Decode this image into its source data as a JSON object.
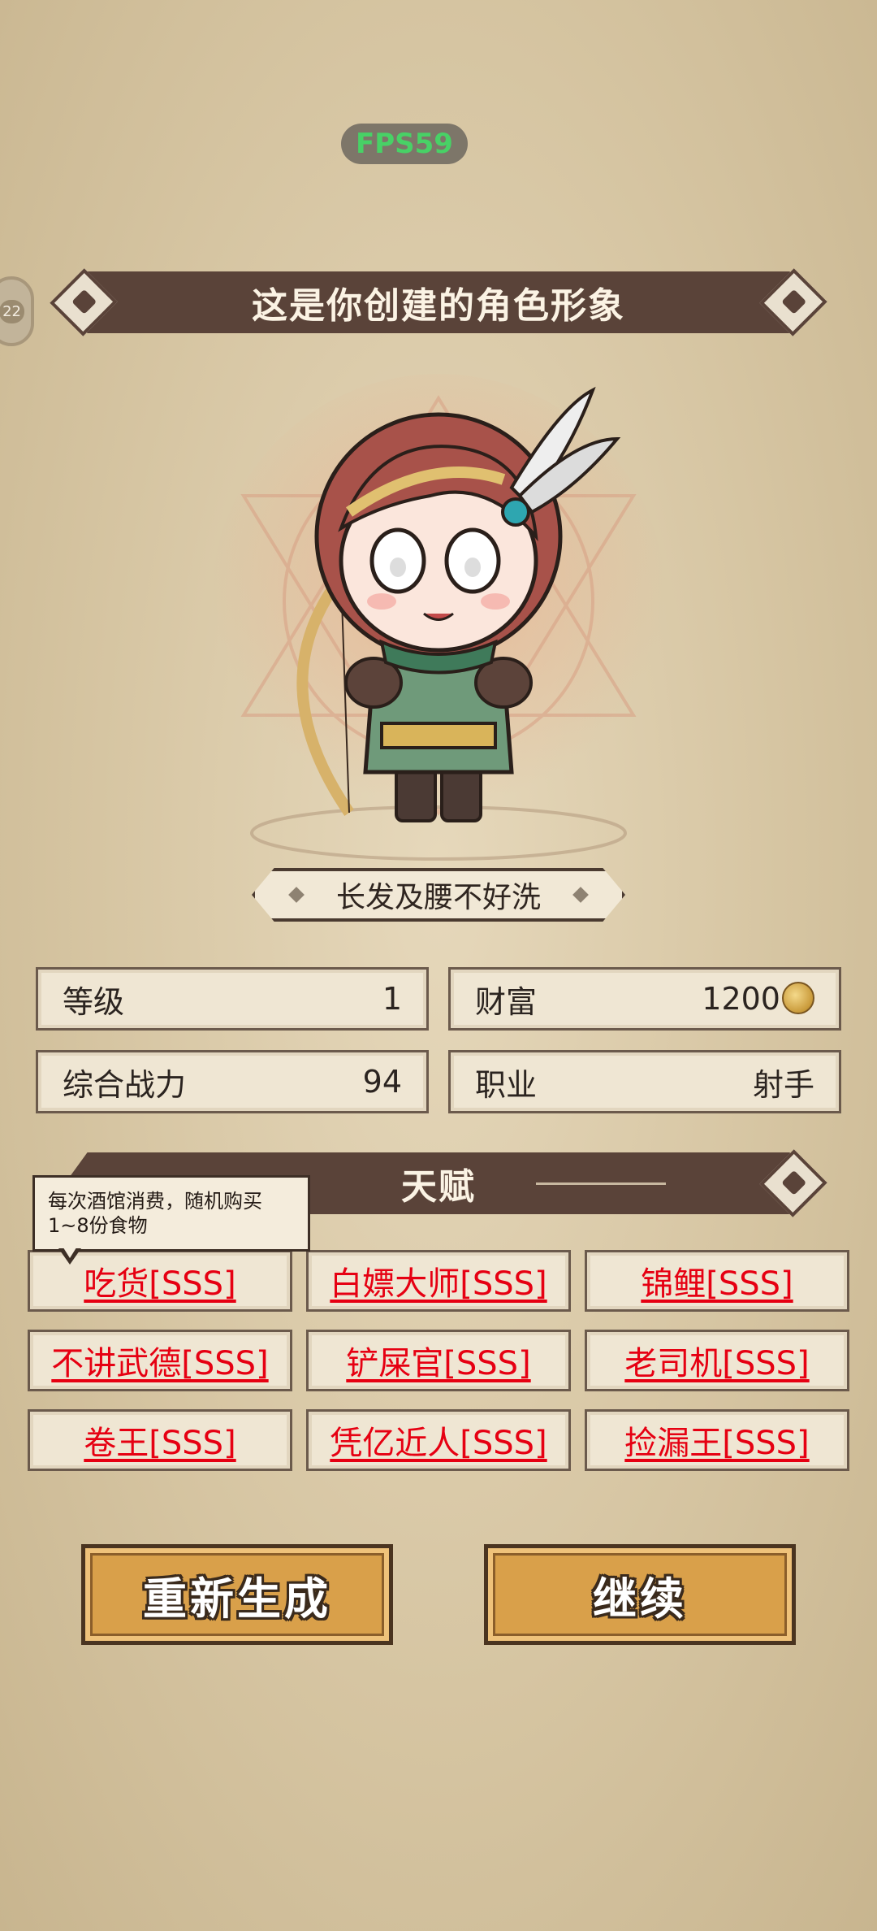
{
  "hud": {
    "fps": "FPS59",
    "side_badge": "22"
  },
  "title": "这是你创建的角色形象",
  "trait_name": "长发及腰不好洗",
  "stats": [
    {
      "label": "等级",
      "value": "1"
    },
    {
      "label": "财富",
      "value": "1200"
    },
    {
      "label": "综合战力",
      "value": "94"
    },
    {
      "label": "职业",
      "value": "射手"
    }
  ],
  "talent_header": "天赋",
  "tooltip": {
    "line1": "每次酒馆消费，随机购买",
    "line2": "1~8份食物"
  },
  "talents": [
    "吃货[SSS]",
    "白嫖大师[SSS]",
    "锦鲤[SSS]",
    "不讲武德[SSS]",
    "铲屎官[SSS]",
    "老司机[SSS]",
    "卷王[SSS]",
    "凭亿近人[SSS]",
    "捡漏王[SSS]"
  ],
  "buttons": {
    "regenerate": "重新生成",
    "continue": "继续"
  },
  "colors": {
    "banner": "#5a4339",
    "talent_text": "#e60012",
    "button": "#d9a04a",
    "fps_text": "#2fd35c"
  }
}
